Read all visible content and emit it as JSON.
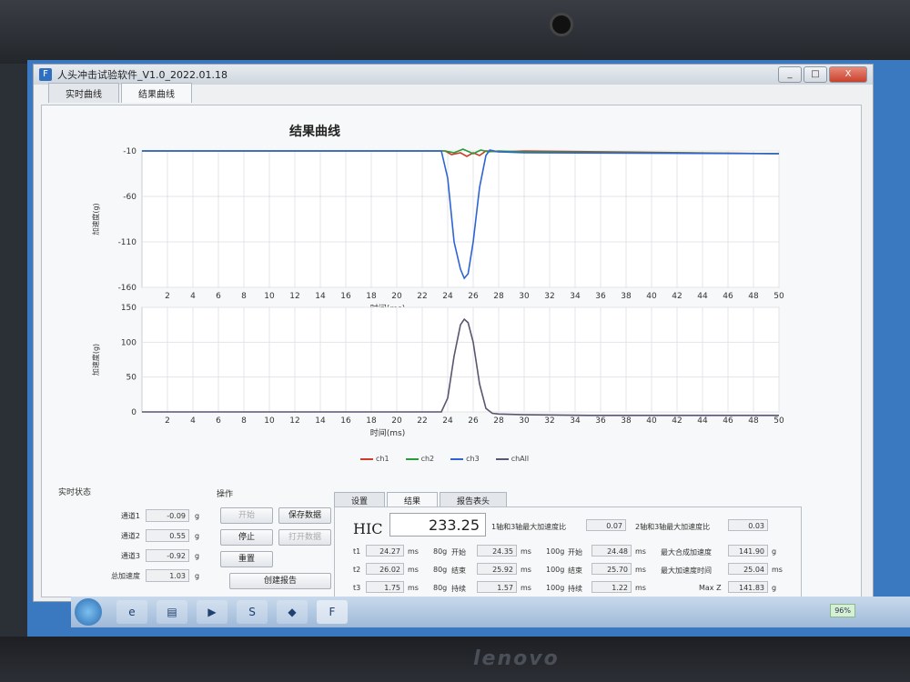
{
  "window": {
    "title": "人头冲击试验软件_V1.0_2022.01.18",
    "buttons": [
      "_",
      "□",
      "X"
    ]
  },
  "tabs": [
    {
      "label": "实时曲线",
      "active": false
    },
    {
      "label": "结果曲线",
      "active": true
    }
  ],
  "chart_title": "结果曲线",
  "chart_data": [
    {
      "type": "line",
      "ylabel": "加速度(g)",
      "xlabel": "时间(ms)",
      "xlim": [
        0,
        50
      ],
      "ylim": [
        -160,
        -10
      ],
      "x_ticks": [
        "2",
        "4",
        "6",
        "8",
        "10",
        "12",
        "14",
        "16",
        "18",
        "20",
        "22",
        "24",
        "26",
        "28",
        "30",
        "32",
        "34",
        "36",
        "38",
        "40",
        "42",
        "44",
        "46",
        "48",
        "50"
      ],
      "y_ticks": [
        "-10",
        "-60",
        "-110",
        "-160"
      ],
      "series": [
        {
          "name": "ch1",
          "color": "#d03a2a",
          "x": [
            0,
            23.8,
            24.3,
            25,
            25.5,
            26,
            26.5,
            27,
            28,
            30,
            50
          ],
          "y": [
            -10,
            -10,
            -14,
            -12,
            -16,
            -12,
            -15,
            -10,
            -11,
            -10,
            -13
          ]
        },
        {
          "name": "ch2",
          "color": "#2a9a3a",
          "x": [
            0,
            23.8,
            24.5,
            25.2,
            26,
            26.6,
            27.2,
            28,
            30,
            50
          ],
          "y": [
            -10,
            -10,
            -12,
            -8,
            -13,
            -9,
            -11,
            -10,
            -11,
            -13
          ]
        },
        {
          "name": "ch3",
          "color": "#2e63d6",
          "x": [
            0,
            23.5,
            24.0,
            24.5,
            25.0,
            25.3,
            25.6,
            26.0,
            26.5,
            27.0,
            27.3,
            28,
            30,
            50
          ],
          "y": [
            -10,
            -10,
            -40,
            -110,
            -140,
            -150,
            -145,
            -110,
            -50,
            -15,
            -9,
            -11,
            -12,
            -13
          ]
        }
      ]
    },
    {
      "type": "line",
      "ylabel": "加速度(g)",
      "xlabel": "时间(ms)",
      "xlim": [
        0,
        50
      ],
      "ylim": [
        0,
        150
      ],
      "x_ticks": [
        "2",
        "4",
        "6",
        "8",
        "10",
        "12",
        "14",
        "16",
        "18",
        "20",
        "22",
        "24",
        "26",
        "28",
        "30",
        "32",
        "34",
        "36",
        "38",
        "40",
        "42",
        "44",
        "46",
        "48",
        "50"
      ],
      "y_ticks": [
        "0",
        "50",
        "100",
        "150"
      ],
      "series": [
        {
          "name": "chAll",
          "color": "#5a5570",
          "x": [
            0,
            23.5,
            24,
            24.5,
            25,
            25.3,
            25.6,
            26,
            26.5,
            27,
            27.5,
            28,
            30,
            35,
            40,
            50
          ],
          "y": [
            0,
            0,
            20,
            80,
            125,
            133,
            128,
            100,
            40,
            5,
            -2,
            -3,
            -4,
            -5,
            -5,
            -6
          ]
        }
      ]
    }
  ],
  "legend": [
    "ch1",
    "ch2",
    "ch3",
    "chAll"
  ],
  "realtime_status": {
    "title": "实时状态",
    "rows": [
      {
        "label": "通道1",
        "value": "-0.09",
        "unit": "g"
      },
      {
        "label": "通道2",
        "value": "0.55",
        "unit": "g"
      },
      {
        "label": "通道3",
        "value": "-0.92",
        "unit": "g"
      },
      {
        "label": "总加速度",
        "value": "1.03",
        "unit": "g"
      }
    ]
  },
  "operations": {
    "title": "操作",
    "start": "开始",
    "save": "保存数据",
    "stop": "停止",
    "open": "打开数据",
    "reset": "重置",
    "create_report": "创建报告"
  },
  "result_tabs": [
    "设置",
    "结果",
    "报告表头"
  ],
  "results": {
    "hic_label": "HIC",
    "hic_value": "233.25",
    "ratio13_label": "1轴和3轴最大加速度比",
    "ratio13_value": "0.07",
    "ratio23_label": "2轴和3轴最大加速度比",
    "ratio23_value": "0.03",
    "t1": "24.27",
    "t2": "26.02",
    "t3": "1.75",
    "g80_start": "24.35",
    "g80_end": "25.92",
    "g80_dur": "1.57",
    "g100_start": "24.48",
    "g100_end": "25.70",
    "g100_dur": "1.22",
    "max_acc_label": "最大合成加速度",
    "max_acc": "141.90",
    "max_acc_time_label": "最大加速度时间",
    "max_acc_time": "25.04",
    "maxz_label": "Max Z",
    "maxz": "141.83",
    "ms": "ms",
    "g": "g",
    "g80": "80g",
    "g100": "100g",
    "start_label": "开始",
    "end_label": "结束",
    "dur_label": "持续",
    "t1_label": "t1",
    "t2_label": "t2",
    "t3_label": "t3"
  },
  "taskbar": {
    "tray_battery": "96%"
  }
}
